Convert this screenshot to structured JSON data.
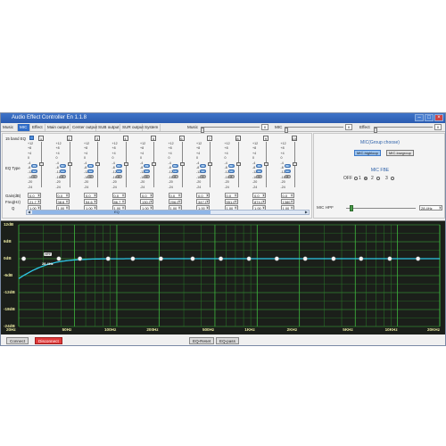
{
  "window": {
    "title": "Audio Effect Controller En 1.1.8"
  },
  "menu": {
    "tabs": [
      "Music",
      "MIC",
      "Effect",
      "Main output",
      "Center output",
      "SUB output",
      "SUR output",
      "System"
    ],
    "active": "MIC",
    "music_label": "Music",
    "music_value": "0",
    "mic_label": "MIC",
    "mic_value": "0",
    "effect_label": "Effect",
    "effect_value": "0"
  },
  "eq": {
    "band_label": "15 band EQ",
    "type_label": "EQ Type",
    "gain_label": "Gain(dB)",
    "freq_label": "Freq(Hz)",
    "q_label": "Q",
    "scale": [
      "+12",
      "+8",
      "+4",
      "0",
      "-4",
      "-8",
      "-12",
      "-16",
      "-20",
      "-24"
    ],
    "channels": [
      {
        "num": "1",
        "gain": "0.0",
        "freq": "21.7",
        "q": "1.00"
      },
      {
        "num": "2",
        "gain": "0.0",
        "freq": "38.6",
        "q": "1.00"
      },
      {
        "num": "3",
        "gain": "0.0",
        "freq": "54.6",
        "q": "1.00"
      },
      {
        "num": "4",
        "gain": "0.0",
        "freq": "86.7",
        "q": "1.00"
      },
      {
        "num": "5",
        "gain": "0.0",
        "freq": "130.0",
        "q": "1.00"
      },
      {
        "num": "6",
        "gain": "0.0",
        "freq": "206.0",
        "q": "1.00"
      },
      {
        "num": "7",
        "gain": "0.0",
        "freq": "347.0",
        "q": "1.00"
      },
      {
        "num": "8",
        "gain": "0.0",
        "freq": "551.0",
        "q": "1.00"
      },
      {
        "num": "9",
        "gain": "0.0",
        "freq": "874.0",
        "q": "1.00"
      },
      {
        "num": "10",
        "gain": "0.0",
        "freq": "1380.0",
        "q": "1.00"
      }
    ],
    "type_buttons": [
      "Pk",
      "Lo",
      "Hi"
    ],
    "scroll_label": "EQ"
  },
  "mic_panel": {
    "group_title": "MIC(Group choose)",
    "group_a": "MIC-highloop",
    "group_b": "MIC-lowgroup",
    "fbe_title": "MIC FBE",
    "fbe_options": [
      "OFF",
      "1",
      "2",
      "3"
    ],
    "fbe_selected": "1",
    "hpf_label": "MIC HPF",
    "hpf_value": "28.4Hz",
    "hpf_level": 0.05
  },
  "graph": {
    "y_labels": [
      "12dB",
      "6dB",
      "0dB",
      "-6dB",
      "-12dB",
      "-18dB",
      "-24dB"
    ],
    "x_labels": [
      "20Hz",
      "50Hz",
      "100Hz",
      "200Hz",
      "500Hz",
      "1KHz",
      "2KHz",
      "5KHz",
      "10KHz",
      "20KHz"
    ],
    "marker_text": "HPF",
    "marker_value": "28.4Hz",
    "curve_color": "#2ec8e8",
    "grid_color": "#3fb83f",
    "point_freqs": [
      21.7,
      38.6,
      54.6,
      86.7,
      130,
      206,
      347,
      551,
      874,
      1380,
      2200,
      3500,
      5500,
      8800,
      14000
    ],
    "hpf_freq": 28.4
  },
  "bottom": {
    "connect": "Connect",
    "disconnect": "Disconnect",
    "eq_reset": "EQ-Reset",
    "eq_pass": "EQ-pass"
  }
}
